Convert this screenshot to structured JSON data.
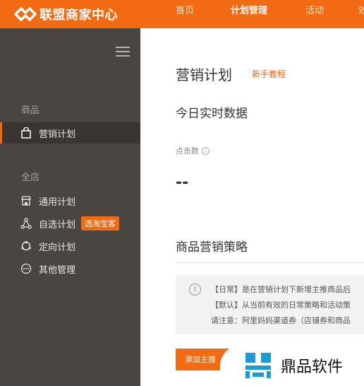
{
  "header": {
    "app_title": "联盟商家中心",
    "nav": [
      "首页",
      "计划管理",
      "活动",
      "效"
    ]
  },
  "sidebar": {
    "group_goods": "商品",
    "marketing_plan": "营销计划",
    "group_store": "全店",
    "items": [
      {
        "label": "通用计划",
        "icon": "store-icon"
      },
      {
        "label": "自选计划",
        "icon": "nodes-icon",
        "badge": "选淘宝客"
      },
      {
        "label": "定向计划",
        "icon": "target-icon"
      },
      {
        "label": "其他管理",
        "icon": "more-icon"
      }
    ]
  },
  "main": {
    "page_title": "营销计划",
    "tutorial_link": "新手教程",
    "realtime_title": "今日实时数据",
    "clicks_label": "点击数",
    "clicks_value": "--",
    "strategy_title": "商品营销策略",
    "notice_lines": [
      "【日常】是在营销计划下新增主推商品后",
      "【默认】从当前有效的日常策略和活动策",
      "请注意：阿里妈妈渠道券（店铺券和商品"
    ],
    "add_button": "添加主推"
  },
  "watermark": {
    "text": "鼎品软件"
  },
  "colors": {
    "accent": "#f26b12",
    "sidebar_bg": "#4a4541",
    "sidebar_active": "#3a3532"
  }
}
